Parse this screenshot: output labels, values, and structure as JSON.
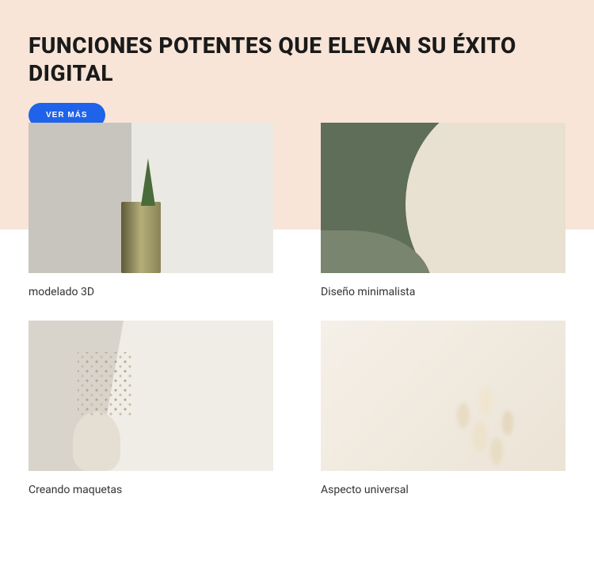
{
  "header": {
    "title": "FUNCIONES POTENTES QUE ELEVAN SU ÉXITO DIGITAL",
    "cta_label": "VER MÁS"
  },
  "features": [
    {
      "label": "modelado 3D"
    },
    {
      "label": "Diseño minimalista"
    },
    {
      "label": "Creando maquetas"
    },
    {
      "label": "Aspecto universal"
    }
  ],
  "colors": {
    "hero_bg": "#f8e5d8",
    "button_bg": "#1e63e9",
    "text_dark": "#1a1a1a"
  }
}
